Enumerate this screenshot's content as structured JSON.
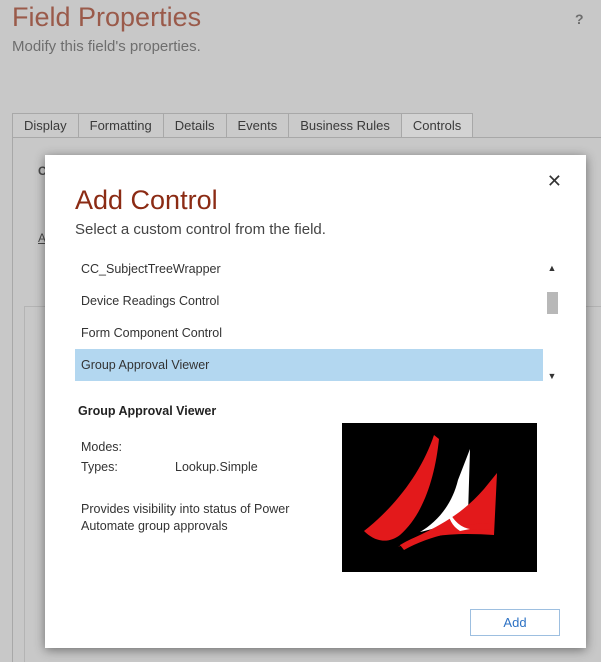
{
  "background": {
    "title": "Field Properties",
    "subtitle": "Modify this field's properties.",
    "help_label": "?",
    "tabs": [
      {
        "label": "Display"
      },
      {
        "label": "Formatting"
      },
      {
        "label": "Details"
      },
      {
        "label": "Events"
      },
      {
        "label": "Business Rules"
      },
      {
        "label": "Controls"
      }
    ],
    "active_tab": "Controls",
    "fragment_c": "C",
    "fragment_a": "A"
  },
  "dialog": {
    "title": "Add Control",
    "subtitle": "Select a custom control from the field.",
    "close_label": "✕",
    "controls": [
      {
        "label": "CC_SubjectTreeWrapper"
      },
      {
        "label": "Device Readings Control"
      },
      {
        "label": "Form Component Control"
      },
      {
        "label": "Group Approval Viewer"
      }
    ],
    "selected_control": "Group Approval Viewer",
    "scroll_up_label": "▲",
    "scroll_down_label": "▼",
    "details": {
      "name": "Group Approval Viewer",
      "modes_label": "Modes:",
      "modes_value": "",
      "types_label": "Types:",
      "types_value": "Lookup.Simple",
      "description": "Provides visibility into status of Power Automate group approvals"
    },
    "add_button_label": "Add",
    "logo_colors": {
      "red": "#e3191b",
      "white": "#ffffff",
      "background": "#000000"
    }
  }
}
